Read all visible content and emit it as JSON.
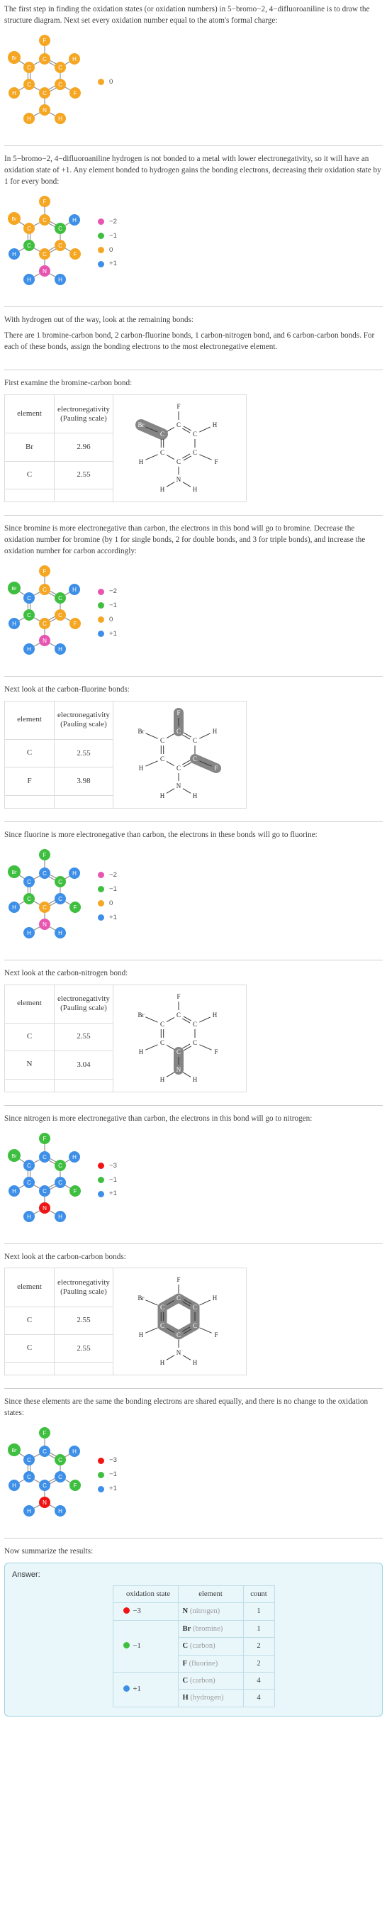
{
  "colors": {
    "orange": "#f5a623",
    "green": "#3fbf3f",
    "blue": "#3d8fe8",
    "magenta": "#e855b0",
    "red": "#f01414",
    "gray_highlight": "#808080",
    "answer_bg": "#e9f7fb",
    "answer_border": "#9fd3df",
    "text": "#404040"
  },
  "compound": "5-bromo-2, 4-difluoroaniline",
  "steps": [
    {
      "id": "step1",
      "paragraphs": [
        "The first step in finding the oxidation states (or oxidation numbers) in 5−bromo−2, 4−difluoroaniline is to draw the structure diagram. Next set every oxidation number equal to the atom's formal charge:"
      ],
      "legend": [
        {
          "color": "#f5a623",
          "label": "0"
        }
      ]
    },
    {
      "id": "step2",
      "paragraphs": [
        "In 5−bromo−2, 4−difluoroaniline hydrogen is not bonded to a metal with lower electronegativity, so it will have an oxidation state of +1. Any element bonded to hydrogen gains the bonding electrons, decreasing their oxidation state by 1 for every bond:"
      ],
      "legend": [
        {
          "color": "#e855b0",
          "label": "−2"
        },
        {
          "color": "#3fbf3f",
          "label": "−1"
        },
        {
          "color": "#f5a623",
          "label": "0"
        },
        {
          "color": "#3d8fe8",
          "label": "+1"
        }
      ]
    },
    {
      "id": "step3",
      "paragraphs": [
        "With hydrogen out of the way, look at the remaining bonds:",
        "There are 1 bromine-carbon bond, 2 carbon-fluorine bonds, 1 carbon-nitrogen bond, and 6 carbon-carbon bonds.  For each of these bonds, assign the bonding electrons to the most electronegative element."
      ]
    },
    {
      "id": "step4",
      "lead": "First examine the bromine-carbon bond:",
      "table": {
        "headers": [
          "element",
          "electronegativity (Pauling scale)"
        ],
        "header_line1": "electronegativity",
        "header_line2": "(Pauling scale)",
        "rows": [
          {
            "element": "Br",
            "value": "2.96"
          },
          {
            "element": "C",
            "value": "2.55"
          }
        ]
      },
      "highlight": "br-c-bond"
    },
    {
      "id": "step5",
      "paragraphs": [
        "Since bromine is more electronegative than carbon, the electrons in this bond will go to bromine. Decrease the oxidation number for bromine (by 1 for single bonds, 2 for double bonds, and 3 for triple bonds), and increase the oxidation number for carbon accordingly:"
      ],
      "legend": [
        {
          "color": "#e855b0",
          "label": "−2"
        },
        {
          "color": "#3fbf3f",
          "label": "−1"
        },
        {
          "color": "#f5a623",
          "label": "0"
        },
        {
          "color": "#3d8fe8",
          "label": "+1"
        }
      ]
    },
    {
      "id": "step6",
      "lead": "Next look at the carbon-fluorine bonds:",
      "table": {
        "header_line1": "electronegativity",
        "header_line2": "(Pauling scale)",
        "rows": [
          {
            "element": "C",
            "value": "2.55"
          },
          {
            "element": "F",
            "value": "3.98"
          }
        ]
      },
      "highlight": "c-f-bonds"
    },
    {
      "id": "step7",
      "paragraphs": [
        "Since fluorine is more electronegative than carbon, the electrons in these bonds will go to fluorine:"
      ],
      "legend": [
        {
          "color": "#e855b0",
          "label": "−2"
        },
        {
          "color": "#3fbf3f",
          "label": "−1"
        },
        {
          "color": "#f5a623",
          "label": "0"
        },
        {
          "color": "#3d8fe8",
          "label": "+1"
        }
      ]
    },
    {
      "id": "step8",
      "lead": "Next look at the carbon-nitrogen bond:",
      "table": {
        "header_line1": "electronegativity",
        "header_line2": "(Pauling scale)",
        "rows": [
          {
            "element": "C",
            "value": "2.55"
          },
          {
            "element": "N",
            "value": "3.04"
          }
        ]
      },
      "highlight": "c-n-bond"
    },
    {
      "id": "step9",
      "paragraphs": [
        "Since nitrogen is more electronegative than carbon, the electrons in this bond will go to nitrogen:"
      ],
      "legend": [
        {
          "color": "#f01414",
          "label": "−3"
        },
        {
          "color": "#3fbf3f",
          "label": "−1"
        },
        {
          "color": "#3d8fe8",
          "label": "+1"
        }
      ]
    },
    {
      "id": "step10",
      "lead": "Next look at the carbon-carbon bonds:",
      "table": {
        "header_line1": "electronegativity",
        "header_line2": "(Pauling scale)",
        "rows": [
          {
            "element": "C",
            "value": "2.55"
          },
          {
            "element": "C",
            "value": "2.55"
          }
        ]
      },
      "highlight": "c-c-bonds"
    },
    {
      "id": "step11",
      "paragraphs": [
        "Since these elements are the same the bonding electrons are shared equally, and there is no change to the oxidation states:"
      ],
      "legend": [
        {
          "color": "#f01414",
          "label": "−3"
        },
        {
          "color": "#3fbf3f",
          "label": "−1"
        },
        {
          "color": "#3d8fe8",
          "label": "+1"
        }
      ]
    }
  ],
  "summary_lead": "Now summarize the results:",
  "answer": {
    "label": "Answer:",
    "headers": {
      "oxidation_state": "oxidation state",
      "element": "element",
      "count": "count"
    },
    "groups": [
      {
        "state": "−3",
        "color": "#f01414",
        "rows": [
          {
            "symbol": "N",
            "name": "(nitrogen)",
            "count": "1"
          }
        ]
      },
      {
        "state": "−1",
        "color": "#3fbf3f",
        "rows": [
          {
            "symbol": "Br",
            "name": "(bromine)",
            "count": "1"
          },
          {
            "symbol": "C",
            "name": "(carbon)",
            "count": "2"
          },
          {
            "symbol": "F",
            "name": "(fluorine)",
            "count": "2"
          }
        ]
      },
      {
        "state": "+1",
        "color": "#3d8fe8",
        "rows": [
          {
            "symbol": "C",
            "name": "(carbon)",
            "count": "4"
          },
          {
            "symbol": "H",
            "name": "(hydrogen)",
            "count": "4"
          }
        ]
      }
    ]
  },
  "molecules": {
    "all_orange": {
      "F_top": "#f5a623",
      "Br": "#f5a623",
      "C1": "#f5a623",
      "C2": "#f5a623",
      "C3": "#f5a623",
      "C4": "#f5a623",
      "C5": "#f5a623",
      "C6": "#f5a623",
      "H_r": "#f5a623",
      "H_l": "#f5a623",
      "F_r": "#f5a623",
      "N": "#f5a623",
      "H_n1": "#f5a623",
      "H_n2": "#f5a623"
    },
    "after_h": {
      "F_top": "#f5a623",
      "Br": "#f5a623",
      "C1": "#f5a623",
      "C2": "#f5a623",
      "C3": "#3fbf3f",
      "C4": "#3fbf3f",
      "C5": "#f5a623",
      "C6": "#f5a623",
      "H_r": "#3d8fe8",
      "H_l": "#3d8fe8",
      "F_r": "#f5a623",
      "N": "#e855b0",
      "H_n1": "#3d8fe8",
      "H_n2": "#3d8fe8"
    },
    "after_br": {
      "F_top": "#f5a623",
      "Br": "#3fbf3f",
      "C1": "#f5a623",
      "C2": "#3d8fe8",
      "C3": "#3fbf3f",
      "C4": "#3fbf3f",
      "C5": "#f5a623",
      "C6": "#f5a623",
      "H_r": "#3d8fe8",
      "H_l": "#3d8fe8",
      "F_r": "#f5a623",
      "N": "#e855b0",
      "H_n1": "#3d8fe8",
      "H_n2": "#3d8fe8"
    },
    "after_f": {
      "F_top": "#3fbf3f",
      "Br": "#3fbf3f",
      "C1": "#3d8fe8",
      "C2": "#3d8fe8",
      "C3": "#3fbf3f",
      "C4": "#3fbf3f",
      "C5": "#3d8fe8",
      "C6": "#f5a623",
      "H_r": "#3d8fe8",
      "H_l": "#3d8fe8",
      "F_r": "#3fbf3f",
      "N": "#e855b0",
      "H_n1": "#3d8fe8",
      "H_n2": "#3d8fe8"
    },
    "after_n": {
      "F_top": "#3fbf3f",
      "Br": "#3fbf3f",
      "C1": "#3d8fe8",
      "C2": "#3d8fe8",
      "C3": "#3fbf3f",
      "C4": "#3d8fe8",
      "C5": "#3d8fe8",
      "C6": "#3d8fe8",
      "H_r": "#3d8fe8",
      "H_l": "#3d8fe8",
      "F_r": "#3fbf3f",
      "N": "#f01414",
      "H_n1": "#3d8fe8",
      "H_n2": "#3d8fe8"
    },
    "final": {
      "F_top": "#3fbf3f",
      "Br": "#3fbf3f",
      "C1": "#3d8fe8",
      "C2": "#3d8fe8",
      "C3": "#3fbf3f",
      "C4": "#3d8fe8",
      "C5": "#3d8fe8",
      "C6": "#3d8fe8",
      "H_r": "#3d8fe8",
      "H_l": "#3d8fe8",
      "F_r": "#3fbf3f",
      "N": "#f01414",
      "H_n1": "#3d8fe8",
      "H_n2": "#3d8fe8"
    }
  }
}
